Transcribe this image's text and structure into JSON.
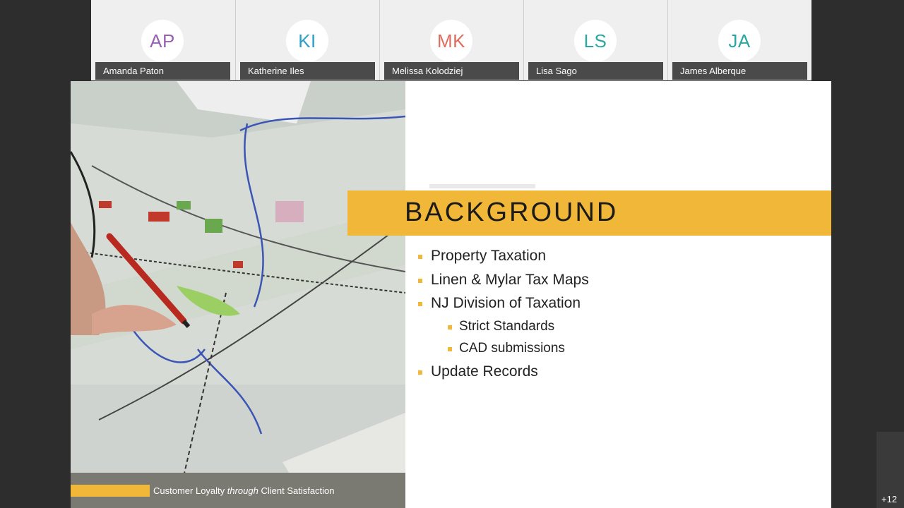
{
  "participants": [
    {
      "initials": "AP",
      "name": "Amanda Paton",
      "color": "#9b5fb3"
    },
    {
      "initials": "KI",
      "name": "Katherine Iles",
      "color": "#2b9fc9"
    },
    {
      "initials": "MK",
      "name": "Melissa Kolodziej",
      "color": "#e06b5e"
    },
    {
      "initials": "LS",
      "name": "Lisa Sago",
      "color": "#2aa7a0"
    },
    {
      "initials": "JA",
      "name": "James Alberque",
      "color": "#2aa7a0"
    }
  ],
  "slide": {
    "title": "BACKGROUND",
    "bullets": [
      {
        "text": "Property Taxation",
        "level": 1
      },
      {
        "text": "Linen & Mylar Tax Maps",
        "level": 1
      },
      {
        "text": "NJ Division of Taxation",
        "level": 1
      },
      {
        "text": "Strict Standards",
        "level": 2
      },
      {
        "text": "CAD submissions",
        "level": 2
      },
      {
        "text": "Update Records",
        "level": 1
      }
    ],
    "footer": {
      "prefix": "Customer Loyalty ",
      "emphasis": "through",
      "suffix": " Client Satisfaction"
    },
    "accent_color": "#f1b738"
  },
  "overflow": {
    "label": "+12"
  }
}
